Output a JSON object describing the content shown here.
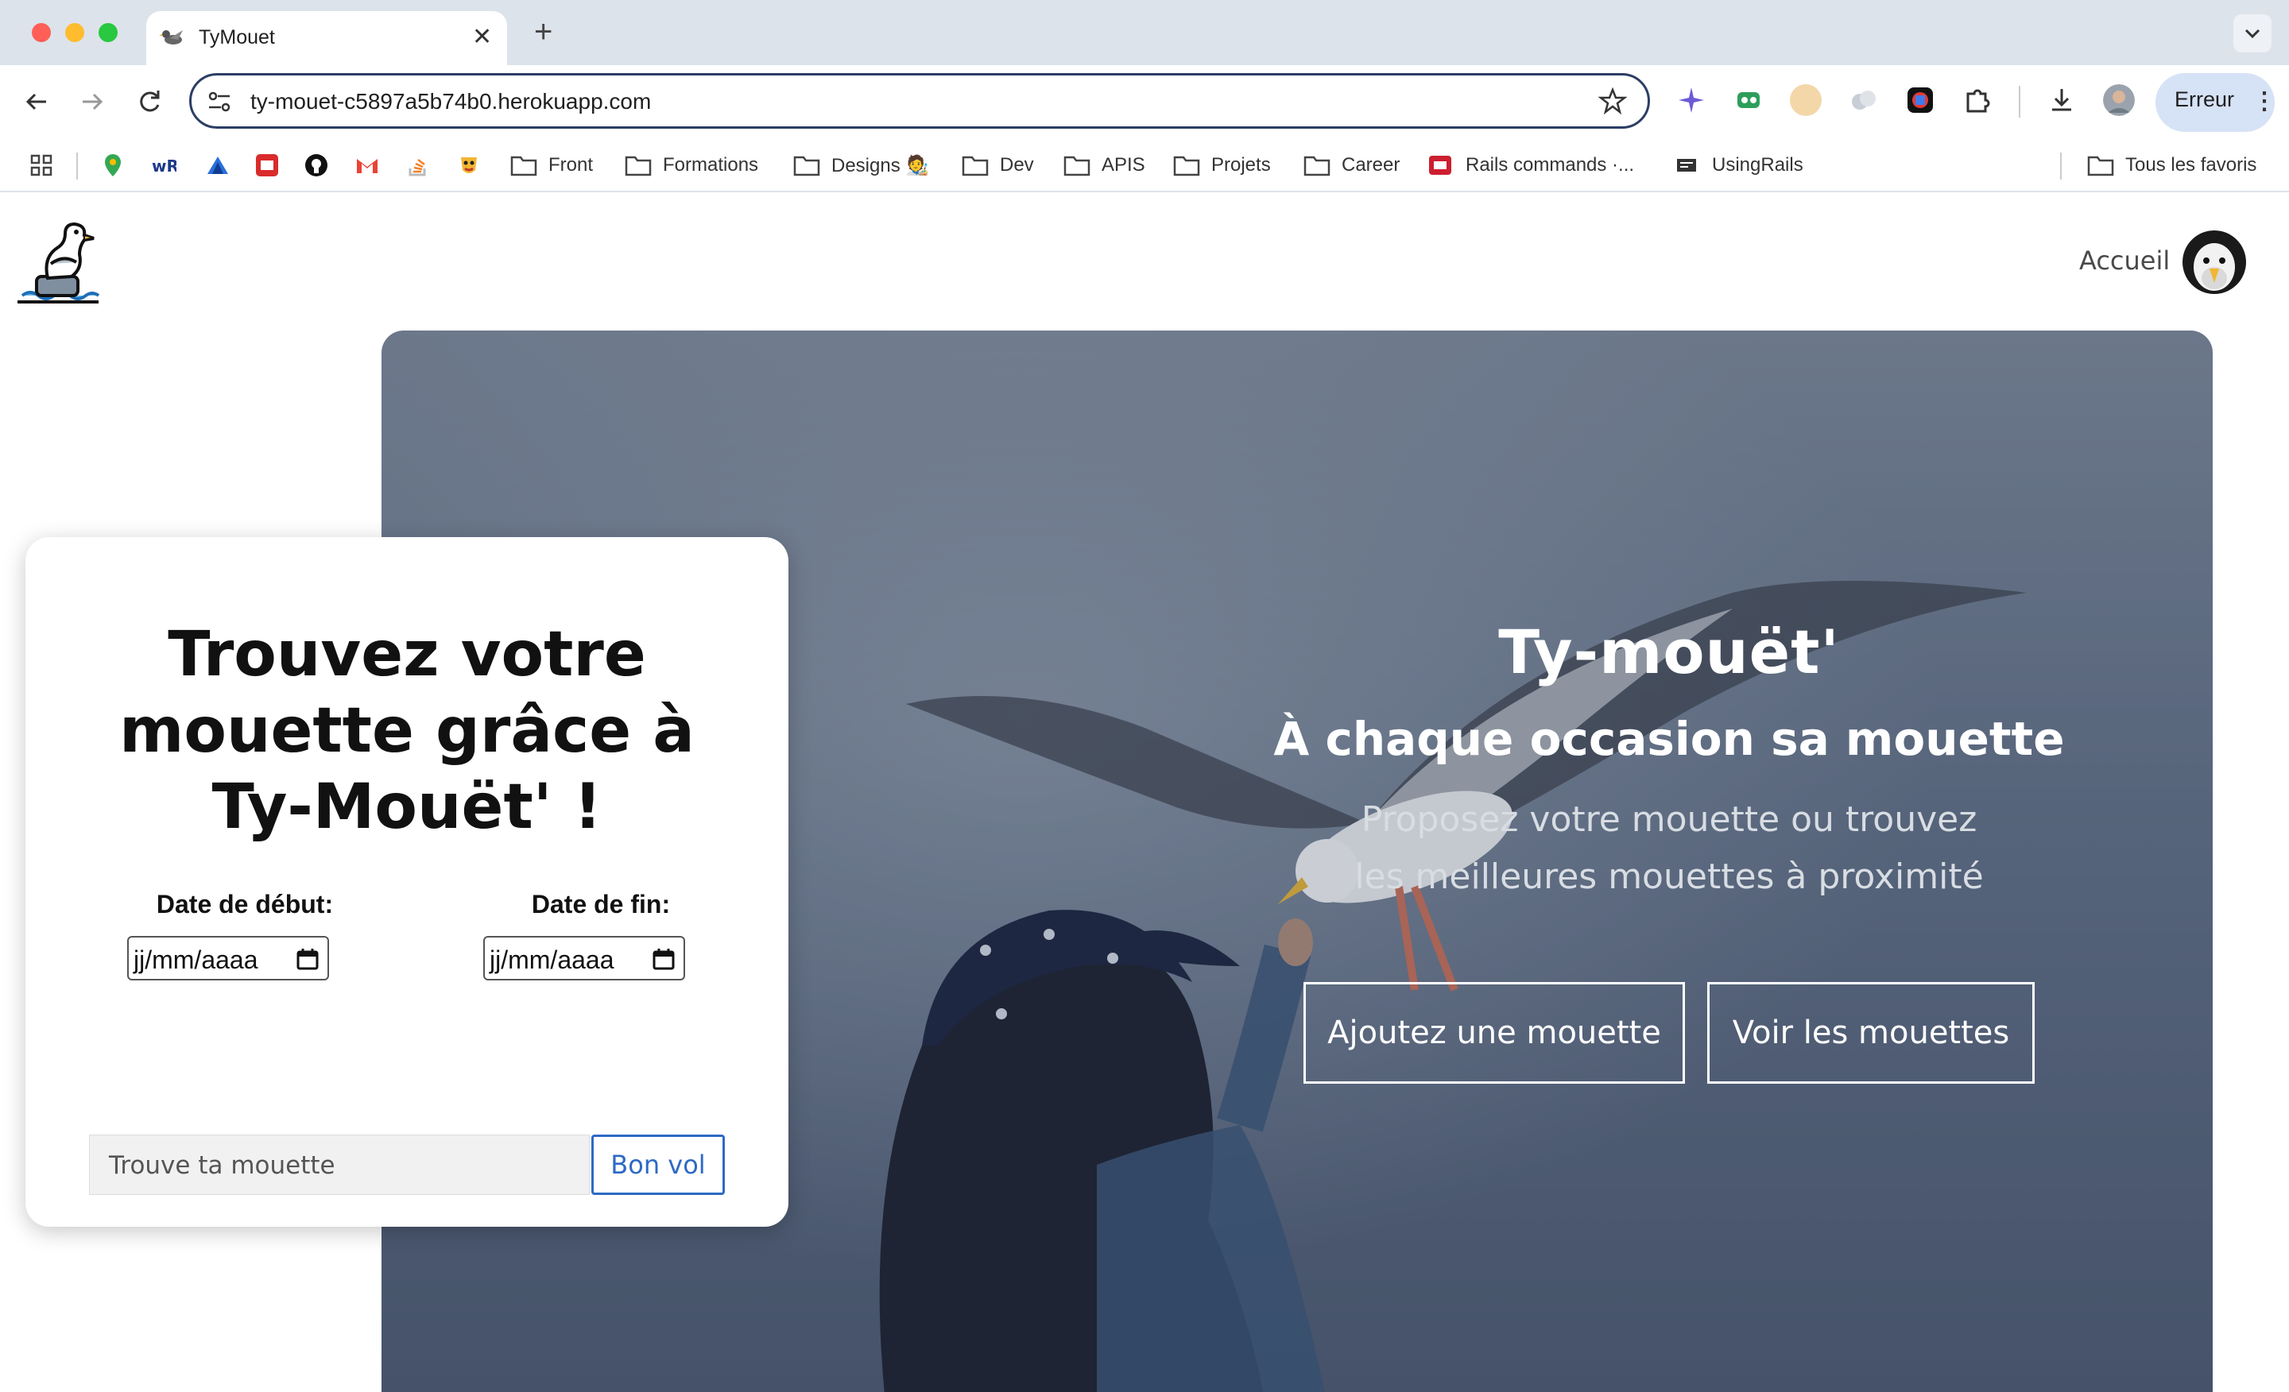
{
  "browser": {
    "tab_title": "TyMouet",
    "new_tab_label": "+",
    "close_label": "✕",
    "url": "ty-mouet-c5897a5b74b0.herokuapp.com",
    "profile_status": "Erreur",
    "bookmarks": {
      "front": "Front",
      "formations": "Formations",
      "designs": "Designs 🧑‍🎨",
      "dev": "Dev",
      "apis": "APIS",
      "projets": "Projets",
      "career": "Career",
      "rails": "Rails commands ·...",
      "usingrails": "UsingRails",
      "favoris": "Tous les favoris"
    }
  },
  "navbar": {
    "home_label": "Accueil"
  },
  "hero": {
    "title": "Ty-mouët'",
    "subtitle": "À chaque occasion sa mouette",
    "description_line1": "Proposez votre mouette ou trouvez",
    "description_line2": "les meilleures mouettes à proximité",
    "add_button": "Ajoutez une mouette",
    "view_button": "Voir les mouettes"
  },
  "search_card": {
    "title_line1": "Trouvez votre",
    "title_line2": "mouette grâce à",
    "title_line3": "Ty-Mouët' !",
    "start_label": "Date de début:",
    "end_label": "Date de fin:",
    "start_value": "jj/mm/aaaa",
    "end_value": "jj/mm/aaaa",
    "search_placeholder": "Trouve ta mouette",
    "submit_label": "Bon vol"
  },
  "colors": {
    "accent": "#2d6ac5",
    "omnibox_border": "#2c3e66",
    "chrome_bg": "#dde3ea"
  }
}
